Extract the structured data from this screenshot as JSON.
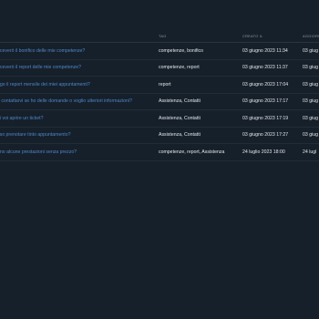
{
  "table": {
    "headers": {
      "tags": "TAG",
      "created": "CREATO IL",
      "updated": "AGGIORN"
    },
    "rows": [
      {
        "question": "riceverò il bonifico delle mie competenze?",
        "tags": "competenze, bonifico",
        "created": "03 giugno 2023 11:34",
        "updated": "03 giug"
      },
      {
        "question": "riceverò il report delle mie competenze?",
        "tags": "competenze, report",
        "created": "03 giugno 2023 11:37",
        "updated": "03 giug"
      },
      {
        "question": "ggo il report mensile dei miei appuntamenti?",
        "tags": "report",
        "created": "03 giugno 2023 17:04",
        "updated": "03 giug"
      },
      {
        "question": "o contattarvi se ho delle domande o voglio ulteriori informazioni?",
        "tags": "Assistenza, Contatti",
        "created": "03 giugno 2023 17:17",
        "updated": "03 giug"
      },
      {
        "question": "oi voi aprire un ticket?",
        "tags": "Assistenza, Contatti",
        "created": "03 giugno 2023 17:19",
        "updated": "03 giug"
      },
      {
        "question": "sso prenotare tinto appuntamento?",
        "tags": "Assistenza, Contatti",
        "created": "03 giugno 2023 17:27",
        "updated": "03 giug"
      },
      {
        "question": "ono alcune prestazioni senza prezzo?",
        "tags": "competenze, report, Assistenza",
        "created": "24 luglio 2023 18:00",
        "updated": "24 lugl"
      }
    ]
  }
}
